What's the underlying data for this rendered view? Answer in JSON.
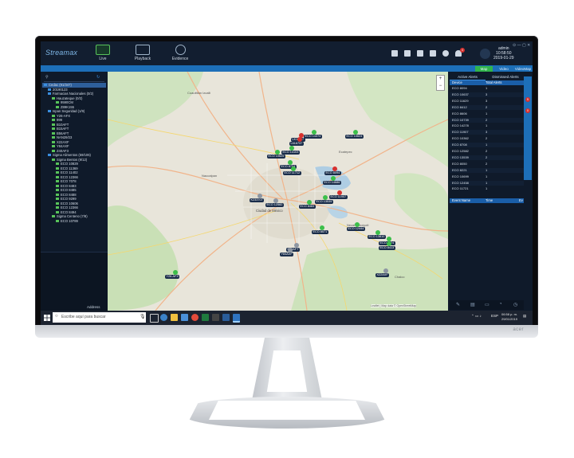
{
  "app": {
    "brand": "Streamax",
    "nav": [
      {
        "label": "Live",
        "active": true
      },
      {
        "label": "Playback",
        "active": false
      },
      {
        "label": "Evidence",
        "active": false
      }
    ],
    "notification_count": "4",
    "user": {
      "name": "admin",
      "time": "10:58:50",
      "date": "2019-01-29"
    },
    "accent": "#31b44b",
    "strip_color": "#1d6fb8"
  },
  "view_tabs": [
    {
      "label": "Map",
      "active": true
    },
    {
      "label": "Video",
      "active": false
    },
    {
      "label": "VideoMap",
      "active": false
    }
  ],
  "tree": [
    {
      "label": "Cedac (91/347)",
      "level": 0,
      "sel": true
    },
    {
      "label": "20190123",
      "level": 1
    },
    {
      "label": "Farmacias Nacionales (0/2)",
      "level": 1
    },
    {
      "label": "Hauzateque (0/2)",
      "level": 2
    },
    {
      "label": "9590CM",
      "level": 3
    },
    {
      "label": "Z89K155",
      "level": 3
    },
    {
      "label": "Ispan Seguridad (1/9)",
      "level": 1
    },
    {
      "label": "Y26-AFX",
      "level": 2
    },
    {
      "label": "999",
      "level": 2
    },
    {
      "label": "B10AFT",
      "level": 2
    },
    {
      "label": "B15AFT",
      "level": 2
    },
    {
      "label": "B56AFT",
      "level": 2
    },
    {
      "label": "NAN29/23",
      "level": 2
    },
    {
      "label": "X22AXF",
      "level": 2
    },
    {
      "label": "Y84AXF",
      "level": 2
    },
    {
      "label": "Z40AF3",
      "level": 2
    },
    {
      "label": "Sigma Alimentos (59/106)",
      "level": 1
    },
    {
      "label": "Sigma Bentos (9/12)",
      "level": 2
    },
    {
      "label": "ECO 10829",
      "level": 3
    },
    {
      "label": "ECO 11369",
      "level": 3
    },
    {
      "label": "ECO 11402",
      "level": 3
    },
    {
      "label": "ECO 12366",
      "level": 3
    },
    {
      "label": "ECO 7078",
      "level": 3
    },
    {
      "label": "ECO 8483",
      "level": 3
    },
    {
      "label": "ECO 8485",
      "level": 3
    },
    {
      "label": "ECO 8488",
      "level": 3
    },
    {
      "label": "ECO 9299",
      "level": 3
    },
    {
      "label": "ECO 10606",
      "level": 3
    },
    {
      "label": "ECO 12366",
      "level": 3
    },
    {
      "label": "ECO 8494",
      "level": 3
    },
    {
      "label": "Sigma Centeno (7/8)",
      "level": 2
    },
    {
      "label": "ECO 10789",
      "level": 3
    }
  ],
  "address_label": "Address",
  "map": {
    "places": [
      "Cuautitlán Izcalli",
      "Ecatepec",
      "Naucalpan",
      "Ciudad de México",
      "Nezahualcóyotl",
      "Chalco"
    ],
    "attribution": "Leaflet | Map data © OpenStreetMap"
  },
  "markers": [
    {
      "label": "ECO 10624",
      "kind": "green"
    },
    {
      "label": "ECO 14374",
      "kind": "green"
    },
    {
      "label": "ECO 10625",
      "kind": "green"
    },
    {
      "label": "LK11147",
      "kind": "red"
    },
    {
      "label": "L616737",
      "kind": "red"
    },
    {
      "label": "ECO 14103",
      "kind": "green"
    },
    {
      "label": "ECO 8704",
      "kind": "green"
    },
    {
      "label": "ECO 11712",
      "kind": "green"
    },
    {
      "label": "ECO 8094",
      "kind": "red"
    },
    {
      "label": "ECO 14686",
      "kind": "green"
    },
    {
      "label": "ECO 11907",
      "kind": "red"
    },
    {
      "label": "K233707",
      "kind": "gray"
    },
    {
      "label": "ECO 12582",
      "kind": "gray"
    },
    {
      "label": "ECO 8483",
      "kind": "green"
    },
    {
      "label": "ECO 13539",
      "kind": "green"
    },
    {
      "label": "ECO 8571",
      "kind": "green"
    },
    {
      "label": "ECO 12444",
      "kind": "green"
    },
    {
      "label": "ECO 13810",
      "kind": "green"
    },
    {
      "label": "ECO 8074",
      "kind": "green"
    },
    {
      "label": "ECO 8413",
      "kind": "green"
    },
    {
      "label": "B50AFT",
      "kind": "gray"
    },
    {
      "label": "Y84AXF",
      "kind": "gray"
    },
    {
      "label": "Y26-AFX",
      "kind": "green"
    },
    {
      "label": "X22AXF",
      "kind": "gray"
    }
  ],
  "alerts": {
    "tabs": [
      "Active Alerts",
      "Dismissed Alerts"
    ],
    "columns": [
      "Device",
      "Total Alerts"
    ],
    "rows": [
      {
        "device": "ECO 8094",
        "total": "1"
      },
      {
        "device": "ECO 10637",
        "total": "3"
      },
      {
        "device": "ECO 11629",
        "total": "3"
      },
      {
        "device": "ECO 8412",
        "total": "2"
      },
      {
        "device": "ECO 8606",
        "total": "1"
      },
      {
        "device": "ECO 10739",
        "total": "2"
      },
      {
        "device": "ECO 14278",
        "total": "1"
      },
      {
        "device": "ECO 11907",
        "total": "3"
      },
      {
        "device": "ECO 10362",
        "total": "2"
      },
      {
        "device": "ECO 8708",
        "total": "1"
      },
      {
        "device": "ECO 12582",
        "total": "2"
      },
      {
        "device": "ECO 13539",
        "total": "2"
      },
      {
        "device": "ECO 8050",
        "total": "2"
      },
      {
        "device": "ECO 8221",
        "total": "1"
      },
      {
        "device": "ECO 10699",
        "total": "1"
      },
      {
        "device": "ECO 12458",
        "total": "1"
      },
      {
        "device": "ECO 11721",
        "total": "1"
      }
    ],
    "event_columns": [
      "Event Name",
      "Time",
      "Ev"
    ]
  },
  "side_badges": [
    "5",
    "0"
  ],
  "taskbar": {
    "search_placeholder": "Escribe aquí para buscar",
    "lang": "ESP",
    "time": "06:58 p. m.",
    "date": "29/01/2019"
  },
  "monitor_logo": "acer"
}
